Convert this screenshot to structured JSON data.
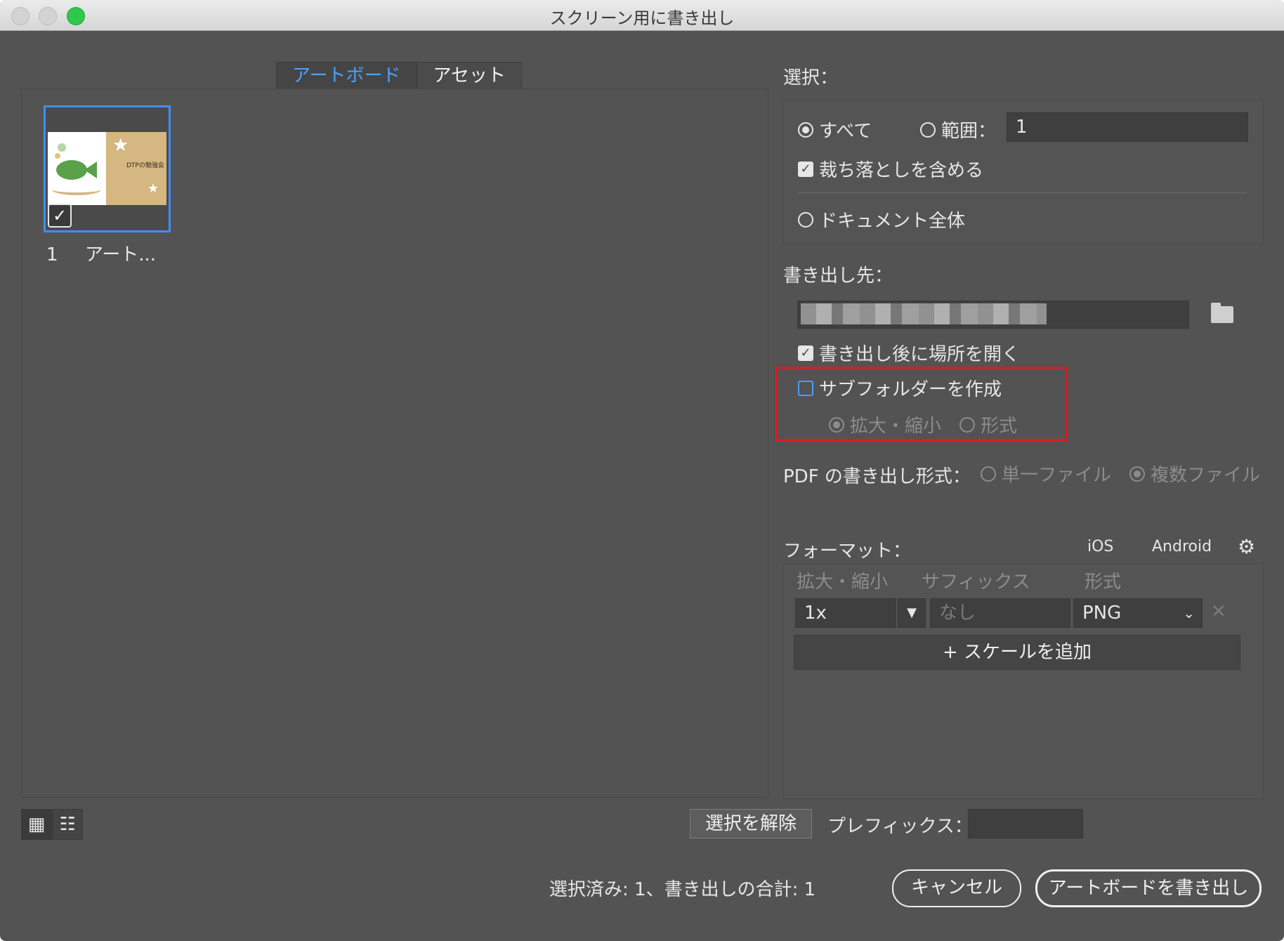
{
  "window": {
    "title": "スクリーン用に書き出し"
  },
  "tabs": {
    "artboard": "アートボード",
    "asset": "アセット"
  },
  "artboard_item": {
    "number": "1",
    "name": "アート...",
    "thumbnail_text": "DTPの勉強会",
    "checked": true
  },
  "selection": {
    "label": "選択：",
    "all": "すべて",
    "range_label": "範囲：",
    "range_value": "1",
    "include_bleed": "裁ち落としを含める",
    "whole_document": "ドキュメント全体"
  },
  "export_to": {
    "label": "書き出し先：",
    "open_after": "書き出し後に場所を開く",
    "create_subfolder": "サブフォルダーを作成",
    "subfolder_scale": "拡大・縮小",
    "subfolder_format": "形式"
  },
  "pdf_export": {
    "label": "PDF の書き出し形式：",
    "single_file": "単一ファイル",
    "multiple_files": "複数ファイル"
  },
  "format": {
    "label": "フォーマット：",
    "ios": "iOS",
    "android": "Android",
    "headers": {
      "scale": "拡大・縮小",
      "suffix": "サフィックス",
      "format": "形式"
    },
    "row": {
      "scale": "1x",
      "suffix_placeholder": "なし",
      "format": "PNG"
    },
    "add_scale": "+ スケールを追加"
  },
  "footer": {
    "deselect": "選択を解除",
    "prefix_label": "プレフィックス：",
    "prefix_value": "",
    "status": "選択済み: 1、書き出しの合計: 1",
    "cancel": "キャンセル",
    "export": "アートボードを書き出し"
  },
  "colors": {
    "background": "#535353",
    "accent": "#3e8ef7",
    "highlight": "#e0191f"
  }
}
